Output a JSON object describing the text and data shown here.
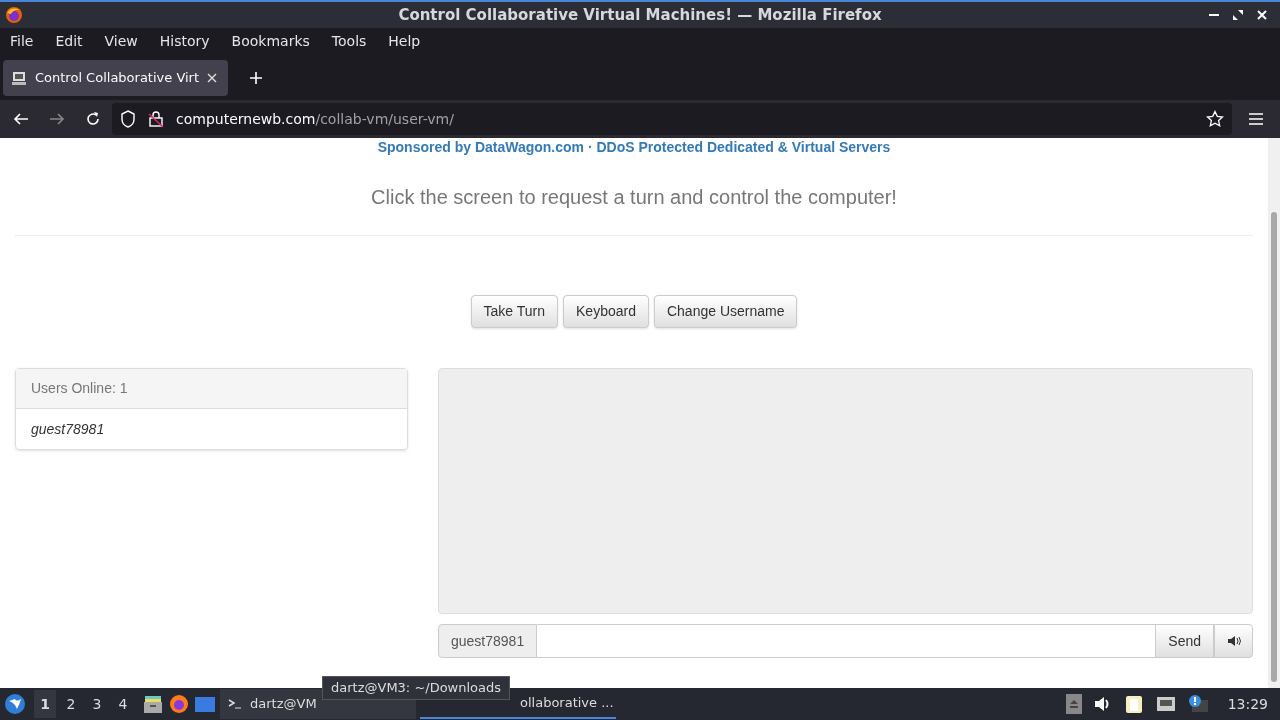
{
  "window": {
    "title": "Control Collaborative Virtual Machines! — Mozilla Firefox"
  },
  "menu": [
    "File",
    "Edit",
    "View",
    "History",
    "Bookmarks",
    "Tools",
    "Help"
  ],
  "tabs": [
    {
      "label": "Control Collaborative Virt",
      "selected": true
    }
  ],
  "address": {
    "domain": "computernewb.com",
    "path": "/collab-vm/user-vm/"
  },
  "page": {
    "sponsor": "Sponsored by DataWagon.com · DDoS Protected Dedicated & Virtual Servers",
    "instruction": "Click the screen to request a turn and control the computer!",
    "buttons": [
      "Take Turn",
      "Keyboard",
      "Change Username"
    ],
    "users": {
      "heading": "Users Online: 1",
      "list": [
        "guest78981"
      ]
    },
    "chat": {
      "username": "guest78981",
      "send": "Send"
    }
  },
  "taskbar": {
    "workspaces": [
      {
        "label": "1",
        "selected": true
      },
      {
        "label": "2",
        "selected": false
      },
      {
        "label": "3",
        "selected": false
      },
      {
        "label": "4",
        "selected": false
      }
    ],
    "tasks": [
      {
        "label": "dartz@VM",
        "selected": false
      },
      {
        "label": "ollaborative ...",
        "selected": true
      }
    ],
    "tooltip": "dartz@VM3: ~/Downloads",
    "clock": "13:29"
  }
}
